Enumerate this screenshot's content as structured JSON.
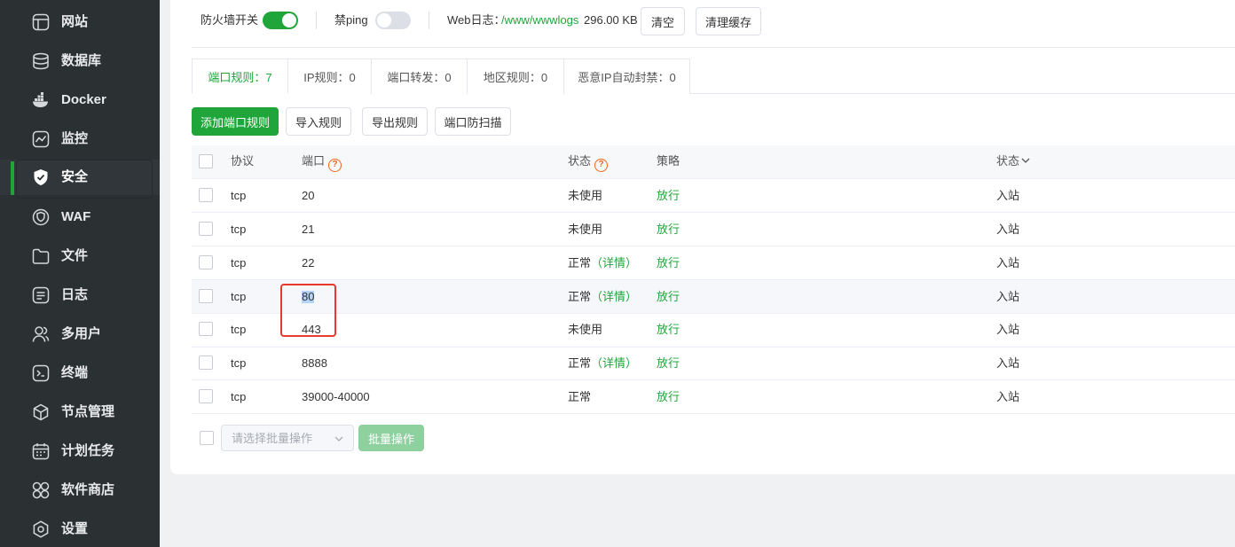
{
  "sidebar": {
    "items": [
      {
        "label": "网站",
        "icon": "website-icon",
        "active": false
      },
      {
        "label": "数据库",
        "icon": "database-icon",
        "active": false
      },
      {
        "label": "Docker",
        "icon": "docker-icon",
        "active": false
      },
      {
        "label": "监控",
        "icon": "monitor-icon",
        "active": false
      },
      {
        "label": "安全",
        "icon": "shield-icon",
        "active": true
      },
      {
        "label": "WAF",
        "icon": "waf-icon",
        "active": false
      },
      {
        "label": "文件",
        "icon": "folder-icon",
        "active": false
      },
      {
        "label": "日志",
        "icon": "log-icon",
        "active": false
      },
      {
        "label": "多用户",
        "icon": "users-icon",
        "active": false
      },
      {
        "label": "终端",
        "icon": "terminal-icon",
        "active": false
      },
      {
        "label": "节点管理",
        "icon": "node-icon",
        "active": false
      },
      {
        "label": "计划任务",
        "icon": "calendar-icon",
        "active": false
      },
      {
        "label": "软件商店",
        "icon": "app-store-icon",
        "active": false
      },
      {
        "label": "设置",
        "icon": "settings-icon",
        "active": false
      }
    ]
  },
  "toolbar": {
    "firewall_label": "防火墙开关",
    "firewall_on": true,
    "ping_label": "禁ping",
    "ping_on": false,
    "weblog_label": "Web日志：",
    "weblog_path": "/www/wwwlogs",
    "weblog_size": "296.00 KB",
    "clear_label": "清空",
    "clear_cache_label": "清理缓存"
  },
  "tabs": [
    {
      "label": "端口规则：7",
      "active": true
    },
    {
      "label": "IP规则：0",
      "active": false
    },
    {
      "label": "端口转发：0",
      "active": false
    },
    {
      "label": "地区规则：0",
      "active": false
    },
    {
      "label": "恶意IP自动封禁：0",
      "active": false
    }
  ],
  "actions": {
    "add": "添加端口规则",
    "import": "导入规则",
    "export": "导出规则",
    "anti_scan": "端口防扫描"
  },
  "table": {
    "headers": {
      "protocol": "协议",
      "port": "端口",
      "status": "状态",
      "policy": "策略",
      "direction": "状态"
    },
    "rows": [
      {
        "protocol": "tcp",
        "port": "20",
        "status": "未使用",
        "detail": "",
        "policy": "放行",
        "direction": "入站"
      },
      {
        "protocol": "tcp",
        "port": "21",
        "status": "未使用",
        "detail": "",
        "policy": "放行",
        "direction": "入站"
      },
      {
        "protocol": "tcp",
        "port": "22",
        "status": "正常",
        "detail": "（详情）",
        "policy": "放行",
        "direction": "入站"
      },
      {
        "protocol": "tcp",
        "port": "80",
        "status": "正常",
        "detail": "（详情）",
        "policy": "放行",
        "direction": "入站"
      },
      {
        "protocol": "tcp",
        "port": "443",
        "status": "未使用",
        "detail": "",
        "policy": "放行",
        "direction": "入站"
      },
      {
        "protocol": "tcp",
        "port": "8888",
        "status": "正常",
        "detail": "（详情）",
        "policy": "放行",
        "direction": "入站"
      },
      {
        "protocol": "tcp",
        "port": "39000-40000",
        "status": "正常",
        "detail": "",
        "policy": "放行",
        "direction": "入站"
      }
    ]
  },
  "batch": {
    "placeholder": "请选择批量操作",
    "button": "批量操作"
  },
  "colors": {
    "accent": "#20a53a",
    "sidebar_bg": "#2b3033",
    "highlight_box": "#e8392c",
    "help_icon": "#f0641a"
  }
}
